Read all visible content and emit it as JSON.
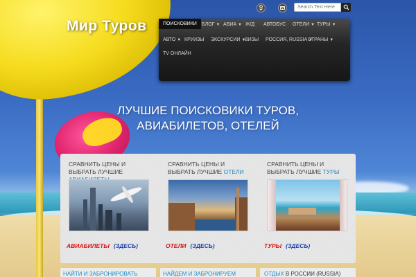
{
  "header": {
    "logo": "Мир Туров",
    "search": {
      "placeholder": "Search Text Here"
    },
    "social": [
      "odnoklassniki-icon",
      "mail-icon"
    ]
  },
  "nav": {
    "items": [
      {
        "label": "ПОИСКОВИКИ",
        "active": true,
        "dropdown": false
      },
      {
        "label": "БЛОГ",
        "dropdown": true
      },
      {
        "label": "АВИА",
        "dropdown": true
      },
      {
        "label": "Ж/Д",
        "dropdown": false
      },
      {
        "label": "АВТОБУС",
        "dropdown": false
      },
      {
        "label": "ОТЕЛИ",
        "dropdown": true
      },
      {
        "label": "ТУРЫ",
        "dropdown": true
      },
      {
        "label": "АВТО",
        "dropdown": true
      },
      {
        "label": "КРУИЗЫ",
        "dropdown": false
      },
      {
        "label": "ЭКСКУРСИИ",
        "dropdown": true
      },
      {
        "label": "ВИЗЫ",
        "dropdown": false
      },
      {
        "label": "РОССИЯ, RUSSIA",
        "dropdown": true
      },
      {
        "label": "СТРАНЫ",
        "dropdown": true
      },
      {
        "label": "TV ОНЛАЙН",
        "dropdown": false
      }
    ]
  },
  "hero": {
    "line1": "ЛУЧШИЕ ПОИСКОВИКИ ТУРОВ,",
    "line2": "АВИАБИЛЕТОВ, ОТЕЛЕЙ"
  },
  "cards": [
    {
      "title_prefix": "СРАВНИТЬ ЦЕНЫ И ВЫБРАТЬ ЛУЧШИЕ",
      "title_highlight": "АВИАБИЛЕТЫ",
      "link_main": "АВИАБИЛЕТЫ",
      "link_here": "(ЗДЕСЬ)",
      "image": "airplanes-city"
    },
    {
      "title_prefix": "СРАВНИТЬ ЦЕНЫ И ВЫБРАТЬ ЛУЧШИЕ",
      "title_highlight": "ОТЕЛИ",
      "link_main": "ОТЕЛИ",
      "link_here": "(ЗДЕСЬ)",
      "image": "venice-canal"
    },
    {
      "title_prefix": "СРАВНИТЬ ЦЕНЫ И ВЫБРАТЬ ЛУЧШИЕ",
      "title_highlight": "ТУРЫ",
      "link_main": "ТУРЫ",
      "link_here": "(ЗДЕСЬ)",
      "image": "beach-resort"
    }
  ],
  "bottom": {
    "box1": "НАЙТИ И ЗАБРОНИРОВАТЬ",
    "box2": "НАЙДЕМ И ЗАБРОНИРУЕМ",
    "box3_a": "ОТДЫХ",
    "box3_b": "В РОССИИ (RUSSIA)"
  },
  "colors": {
    "accent": "#1e88c8",
    "link_red": "#dd1111",
    "link_blue": "#1a3fb0",
    "nav_bg": "#1a1a1a"
  }
}
